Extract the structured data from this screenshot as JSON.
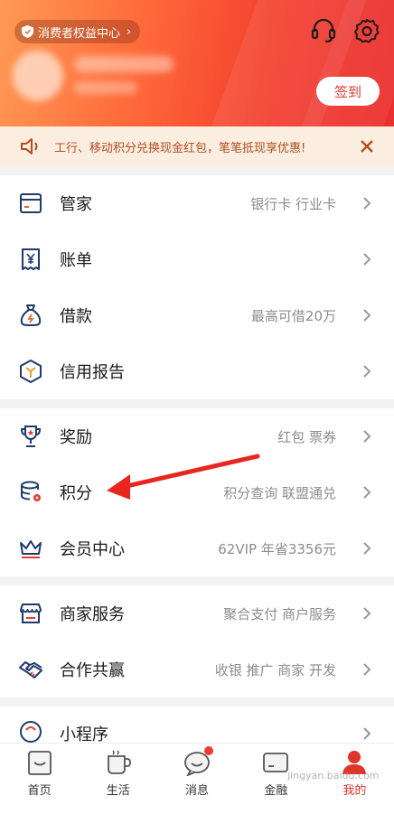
{
  "header": {
    "rights_label": "消费者权益中心",
    "checkin_label": "签到"
  },
  "notice": {
    "text": "工行、移动积分兑换现金红包，笔笔抵现享优惠!"
  },
  "groups": [
    [
      {
        "label": "管家",
        "hint": "银行卡 行业卡",
        "icon": "wallet-card-icon"
      },
      {
        "label": "账单",
        "hint": "",
        "icon": "bill-yen-icon"
      },
      {
        "label": "借款",
        "hint": "最高可借20万",
        "icon": "money-bag-icon"
      },
      {
        "label": "信用报告",
        "hint": "",
        "icon": "credit-hexagon-icon"
      }
    ],
    [
      {
        "label": "奖励",
        "hint": "红包 票券",
        "icon": "trophy-icon"
      },
      {
        "label": "积分",
        "hint": "积分查询 联盟通兑",
        "icon": "coin-stack-icon"
      },
      {
        "label": "会员中心",
        "hint": "62VIP 年省3356元",
        "icon": "crown-icon"
      }
    ],
    [
      {
        "label": "商家服务",
        "hint": "聚合支付 商户服务",
        "icon": "store-icon"
      },
      {
        "label": "合作共赢",
        "hint": "收银 推广 商家 开发",
        "icon": "handshake-icon"
      }
    ],
    [
      {
        "label": "小程序",
        "hint": "",
        "icon": "mini-program-icon"
      }
    ]
  ],
  "bottom_nav": [
    {
      "label": "首页",
      "icon": "home-icon",
      "active": false
    },
    {
      "label": "生活",
      "icon": "cup-icon",
      "active": false
    },
    {
      "label": "消息",
      "icon": "message-icon",
      "active": false
    },
    {
      "label": "金融",
      "icon": "card-icon",
      "active": false
    },
    {
      "label": "我的",
      "icon": "profile-icon",
      "active": true
    }
  ],
  "watermark": "jingyan.baidu.com",
  "colors": {
    "accent": "#e0352b",
    "notice_bg": "#fbeee1",
    "notice_text": "#b34d1e",
    "icon_navy": "#1f3a6b"
  }
}
